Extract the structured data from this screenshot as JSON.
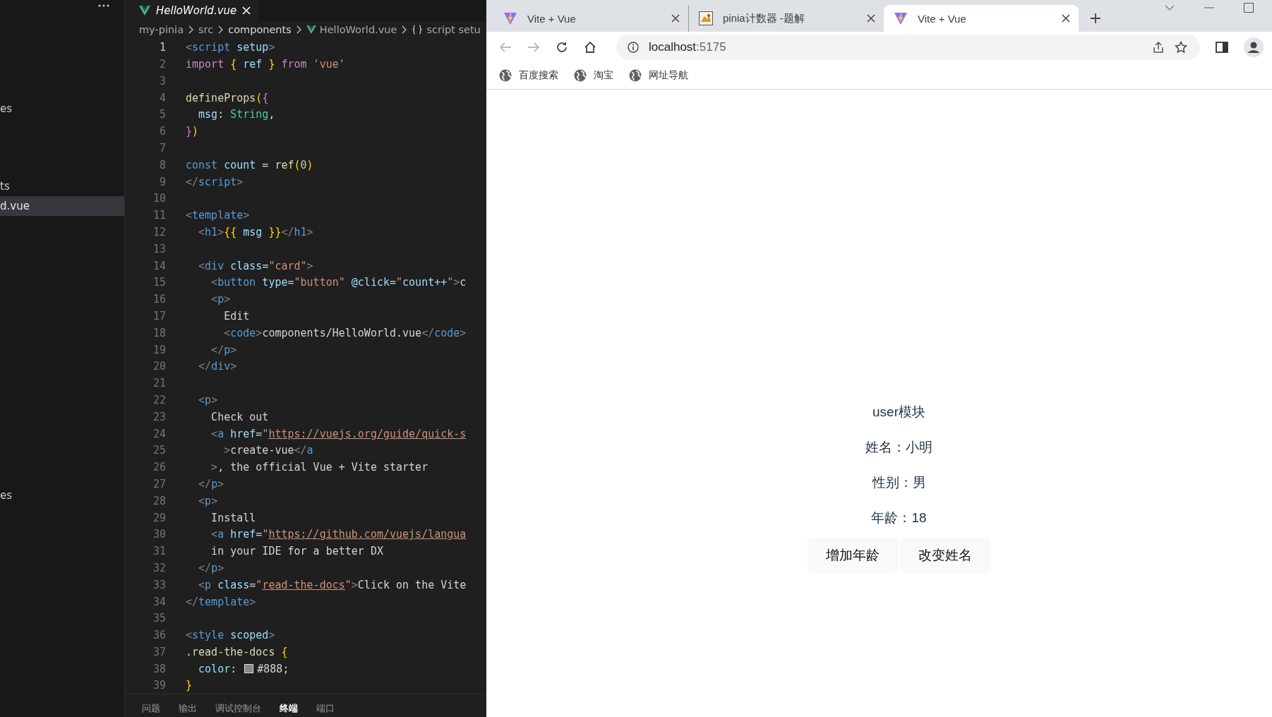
{
  "sidebar": {
    "items": [
      {
        "label": "es",
        "selected": false
      },
      {
        "label": "ts",
        "selected": false
      },
      {
        "label": "d.vue",
        "selected": true
      },
      {
        "label": "es",
        "selected": false
      }
    ]
  },
  "editor": {
    "tab": {
      "title": "HelloWorld.vue"
    },
    "breadcrumbs": [
      {
        "label": "my-pinia",
        "kind": "folder"
      },
      {
        "label": "src",
        "kind": "folder"
      },
      {
        "label": "components",
        "kind": "folder"
      },
      {
        "label": "HelloWorld.vue",
        "kind": "vue"
      },
      {
        "label": "script setu",
        "kind": "symbol"
      }
    ],
    "lines": [
      {
        "n": "1",
        "current": true,
        "tokens": [
          {
            "kind": "punct",
            "text": "<"
          },
          {
            "kind": "tag",
            "text": "script"
          },
          {
            "kind": "attr",
            "text": " setup"
          },
          {
            "kind": "punct",
            "text": ">"
          }
        ]
      },
      {
        "n": "2",
        "current": false,
        "tokens": [
          {
            "kind": "keyword",
            "text": "import"
          },
          {
            "kind": "bracket",
            "text": " {"
          },
          {
            "kind": "attr",
            "text": " ref"
          },
          {
            "kind": "bracket",
            "text": " }"
          },
          {
            "kind": "keyword",
            "text": " from"
          },
          {
            "kind": "string",
            "text": " 'vue'"
          }
        ]
      },
      {
        "n": "3",
        "current": false
      },
      {
        "n": "4",
        "current": false,
        "tokens": [
          {
            "kind": "func",
            "text": "defineProps"
          },
          {
            "kind": "bracket",
            "text": "("
          },
          {
            "kind": "bracket2",
            "text": "{"
          }
        ]
      },
      {
        "n": "5",
        "current": false,
        "tokens": [
          {
            "kind": "attr",
            "text": "  msg"
          },
          {
            "kind": "plain",
            "text": ": "
          },
          {
            "kind": "type",
            "text": "String"
          },
          {
            "kind": "plain",
            "text": ","
          }
        ]
      },
      {
        "n": "6",
        "current": false,
        "tokens": [
          {
            "kind": "bracket2",
            "text": "}"
          },
          {
            "kind": "bracket",
            "text": ")"
          }
        ]
      },
      {
        "n": "7",
        "current": false
      },
      {
        "n": "8",
        "current": false,
        "tokens": [
          {
            "kind": "storage",
            "text": "const"
          },
          {
            "kind": "attr",
            "text": " count"
          },
          {
            "kind": "plain",
            "text": " = "
          },
          {
            "kind": "func",
            "text": "ref"
          },
          {
            "kind": "bracket",
            "text": "("
          },
          {
            "kind": "number",
            "text": "0"
          },
          {
            "kind": "bracket",
            "text": ")"
          }
        ]
      },
      {
        "n": "9",
        "current": false,
        "tokens": [
          {
            "kind": "punct",
            "text": "</"
          },
          {
            "kind": "tag",
            "text": "script"
          },
          {
            "kind": "punct",
            "text": ">"
          }
        ]
      },
      {
        "n": "10",
        "current": false
      },
      {
        "n": "11",
        "current": false,
        "tokens": [
          {
            "kind": "punct",
            "text": "<"
          },
          {
            "kind": "tag",
            "text": "template"
          },
          {
            "kind": "punct",
            "text": ">"
          }
        ]
      },
      {
        "n": "12",
        "current": false,
        "tokens": [
          {
            "kind": "punct",
            "text": "  <"
          },
          {
            "kind": "tag",
            "text": "h1"
          },
          {
            "kind": "punct",
            "text": ">"
          },
          {
            "kind": "bracket",
            "text": "{{"
          },
          {
            "kind": "attr",
            "text": " msg"
          },
          {
            "kind": "bracket",
            "text": " }}"
          },
          {
            "kind": "punct",
            "text": "</"
          },
          {
            "kind": "tag",
            "text": "h1"
          },
          {
            "kind": "punct",
            "text": ">"
          }
        ]
      },
      {
        "n": "13",
        "current": false
      },
      {
        "n": "14",
        "current": false,
        "tokens": [
          {
            "kind": "punct",
            "text": "  <"
          },
          {
            "kind": "tag",
            "text": "div"
          },
          {
            "kind": "attr",
            "text": " class"
          },
          {
            "kind": "plain",
            "text": "="
          },
          {
            "kind": "string",
            "text": "\"card\""
          },
          {
            "kind": "punct",
            "text": ">"
          }
        ]
      },
      {
        "n": "15",
        "current": false,
        "tokens": [
          {
            "kind": "punct",
            "text": "    <"
          },
          {
            "kind": "tag",
            "text": "button"
          },
          {
            "kind": "attr",
            "text": " type"
          },
          {
            "kind": "plain",
            "text": "="
          },
          {
            "kind": "string",
            "text": "\"button\""
          },
          {
            "kind": "attr",
            "text": " @click"
          },
          {
            "kind": "plain",
            "text": "="
          },
          {
            "kind": "string",
            "text": "\""
          },
          {
            "kind": "attr",
            "text": "count++"
          },
          {
            "kind": "string",
            "text": "\""
          },
          {
            "kind": "punct",
            "text": ">"
          },
          {
            "kind": "plain",
            "text": "c"
          }
        ]
      },
      {
        "n": "16",
        "current": false,
        "tokens": [
          {
            "kind": "punct",
            "text": "    <"
          },
          {
            "kind": "tag",
            "text": "p"
          },
          {
            "kind": "punct",
            "text": ">"
          }
        ]
      },
      {
        "n": "17",
        "current": false,
        "tokens": [
          {
            "kind": "plain",
            "text": "      Edit"
          }
        ]
      },
      {
        "n": "18",
        "current": false,
        "tokens": [
          {
            "kind": "punct",
            "text": "      <"
          },
          {
            "kind": "tag",
            "text": "code"
          },
          {
            "kind": "punct",
            "text": ">"
          },
          {
            "kind": "plain",
            "text": "components/HelloWorld.vue"
          },
          {
            "kind": "punct",
            "text": "</"
          },
          {
            "kind": "tag",
            "text": "code"
          },
          {
            "kind": "punct",
            "text": ">"
          }
        ]
      },
      {
        "n": "19",
        "current": false,
        "tokens": [
          {
            "kind": "punct",
            "text": "    </"
          },
          {
            "kind": "tag",
            "text": "p"
          },
          {
            "kind": "punct",
            "text": ">"
          }
        ]
      },
      {
        "n": "20",
        "current": false,
        "tokens": [
          {
            "kind": "punct",
            "text": "  </"
          },
          {
            "kind": "tag",
            "text": "div"
          },
          {
            "kind": "punct",
            "text": ">"
          }
        ]
      },
      {
        "n": "21",
        "current": false
      },
      {
        "n": "22",
        "current": false,
        "tokens": [
          {
            "kind": "punct",
            "text": "  <"
          },
          {
            "kind": "tag",
            "text": "p"
          },
          {
            "kind": "punct",
            "text": ">"
          }
        ]
      },
      {
        "n": "23",
        "current": false,
        "tokens": [
          {
            "kind": "plain",
            "text": "    Check out"
          }
        ]
      },
      {
        "n": "24",
        "current": false,
        "tokens": [
          {
            "kind": "punct",
            "text": "    <"
          },
          {
            "kind": "tag",
            "text": "a"
          },
          {
            "kind": "attr",
            "text": " href"
          },
          {
            "kind": "plain",
            "text": "="
          },
          {
            "kind": "string",
            "text": "\""
          },
          {
            "kind": "url",
            "text": "https://vuejs.org/guide/quick-s"
          }
        ]
      },
      {
        "n": "25",
        "current": false,
        "tokens": [
          {
            "kind": "punct",
            "text": "      >"
          },
          {
            "kind": "plain",
            "text": "create-vue"
          },
          {
            "kind": "punct",
            "text": "</"
          },
          {
            "kind": "tag",
            "text": "a"
          }
        ]
      },
      {
        "n": "26",
        "current": false,
        "tokens": [
          {
            "kind": "punct",
            "text": "    >"
          },
          {
            "kind": "plain",
            "text": ", the official Vue + Vite starter"
          }
        ]
      },
      {
        "n": "27",
        "current": false,
        "tokens": [
          {
            "kind": "punct",
            "text": "  </"
          },
          {
            "kind": "tag",
            "text": "p"
          },
          {
            "kind": "punct",
            "text": ">"
          }
        ]
      },
      {
        "n": "28",
        "current": false,
        "tokens": [
          {
            "kind": "punct",
            "text": "  <"
          },
          {
            "kind": "tag",
            "text": "p"
          },
          {
            "kind": "punct",
            "text": ">"
          }
        ]
      },
      {
        "n": "29",
        "current": false,
        "tokens": [
          {
            "kind": "plain",
            "text": "    Install"
          }
        ]
      },
      {
        "n": "30",
        "current": false,
        "tokens": [
          {
            "kind": "punct",
            "text": "    <"
          },
          {
            "kind": "tag",
            "text": "a"
          },
          {
            "kind": "attr",
            "text": " href"
          },
          {
            "kind": "plain",
            "text": "="
          },
          {
            "kind": "string",
            "text": "\""
          },
          {
            "kind": "url",
            "text": "https://github.com/vuejs/langua"
          }
        ]
      },
      {
        "n": "31",
        "current": false,
        "tokens": [
          {
            "kind": "plain",
            "text": "    in your IDE for a better DX"
          }
        ]
      },
      {
        "n": "32",
        "current": false,
        "tokens": [
          {
            "kind": "punct",
            "text": "  </"
          },
          {
            "kind": "tag",
            "text": "p"
          },
          {
            "kind": "punct",
            "text": ">"
          }
        ]
      },
      {
        "n": "33",
        "current": false,
        "tokens": [
          {
            "kind": "punct",
            "text": "  <"
          },
          {
            "kind": "tag",
            "text": "p"
          },
          {
            "kind": "attr",
            "text": " class"
          },
          {
            "kind": "plain",
            "text": "="
          },
          {
            "kind": "string",
            "text": "\""
          },
          {
            "kind": "url",
            "text": "read-the-docs"
          },
          {
            "kind": "string",
            "text": "\""
          },
          {
            "kind": "punct",
            "text": ">"
          },
          {
            "kind": "plain",
            "text": "Click on the Vite"
          }
        ]
      },
      {
        "n": "34",
        "current": false,
        "tokens": [
          {
            "kind": "punct",
            "text": "</"
          },
          {
            "kind": "tag",
            "text": "template"
          },
          {
            "kind": "punct",
            "text": ">"
          }
        ]
      },
      {
        "n": "35",
        "current": false
      },
      {
        "n": "36",
        "current": false,
        "tokens": [
          {
            "kind": "punct",
            "text": "<"
          },
          {
            "kind": "tag",
            "text": "style"
          },
          {
            "kind": "attr",
            "text": " scoped"
          },
          {
            "kind": "punct",
            "text": ">"
          }
        ]
      },
      {
        "n": "37",
        "current": false,
        "tokens": [
          {
            "kind": "func",
            "text": ".read-the-docs"
          },
          {
            "kind": "bracket",
            "text": " {"
          }
        ]
      },
      {
        "n": "38",
        "current": false,
        "tokens": [
          {
            "kind": "attr",
            "text": "  color"
          },
          {
            "kind": "plain",
            "text": ": "
          },
          {
            "kind": "swatch",
            "color": "#888888"
          },
          {
            "kind": "plain",
            "text": "#888;"
          }
        ]
      },
      {
        "n": "39",
        "current": false,
        "tokens": [
          {
            "kind": "bracket",
            "text": "}"
          }
        ]
      }
    ]
  },
  "panel": {
    "tabs": [
      {
        "label": "问题",
        "selected": false
      },
      {
        "label": "输出",
        "selected": false
      },
      {
        "label": "调试控制台",
        "selected": false
      },
      {
        "label": "终端",
        "selected": true
      },
      {
        "label": "端口",
        "selected": false
      }
    ]
  },
  "browser": {
    "tabs": [
      {
        "title": "Vite + Vue",
        "kind": "vite",
        "selected": false
      },
      {
        "title": "pinia计数器 -题解",
        "kind": "image",
        "selected": false
      },
      {
        "title": "Vite + Vue",
        "kind": "vite",
        "selected": true
      }
    ],
    "address": {
      "host": "localhost",
      "port": ":5175"
    },
    "bookmarks": [
      "百度搜索",
      "淘宝",
      "网址导航"
    ],
    "page": {
      "heading": "user模块",
      "lines": [
        "姓名：小明",
        "性别：男",
        "年龄：18"
      ],
      "buttons": [
        "增加年龄",
        "改变姓名"
      ]
    }
  }
}
